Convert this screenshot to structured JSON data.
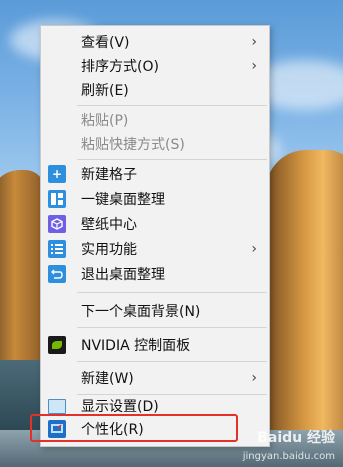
{
  "menu": {
    "items": [
      {
        "label": "查看(V)",
        "submenu": "›"
      },
      {
        "label": "排序方式(O)",
        "submenu": "›"
      },
      {
        "label": "刷新(E)"
      },
      {
        "label": "粘贴(P)"
      },
      {
        "label": "粘贴快捷方式(S)"
      },
      {
        "label": "新建格子"
      },
      {
        "label": "一键桌面整理"
      },
      {
        "label": "壁纸中心"
      },
      {
        "label": "实用功能",
        "submenu": "›"
      },
      {
        "label": "退出桌面整理"
      },
      {
        "label": "下一个桌面背景(N)"
      },
      {
        "label": "NVIDIA 控制面板"
      },
      {
        "label": "新建(W)",
        "submenu": "›"
      },
      {
        "label": "显示设置(D)"
      },
      {
        "label": "个性化(R)"
      }
    ]
  },
  "icons": {
    "new_grid": "plus-icon",
    "one_key": "layout-icon",
    "wallpaper": "cube-icon",
    "utility": "list-icon",
    "exit": "return-icon",
    "nvidia": "nvidia-icon",
    "display": "display-icon",
    "personalize": "personalize-icon"
  },
  "colors": {
    "highlight": "#e2312a",
    "accent": "#2f8fdf"
  },
  "watermark": {
    "brand": "Baidu 经验",
    "url": "jingyan.baidu.com"
  }
}
